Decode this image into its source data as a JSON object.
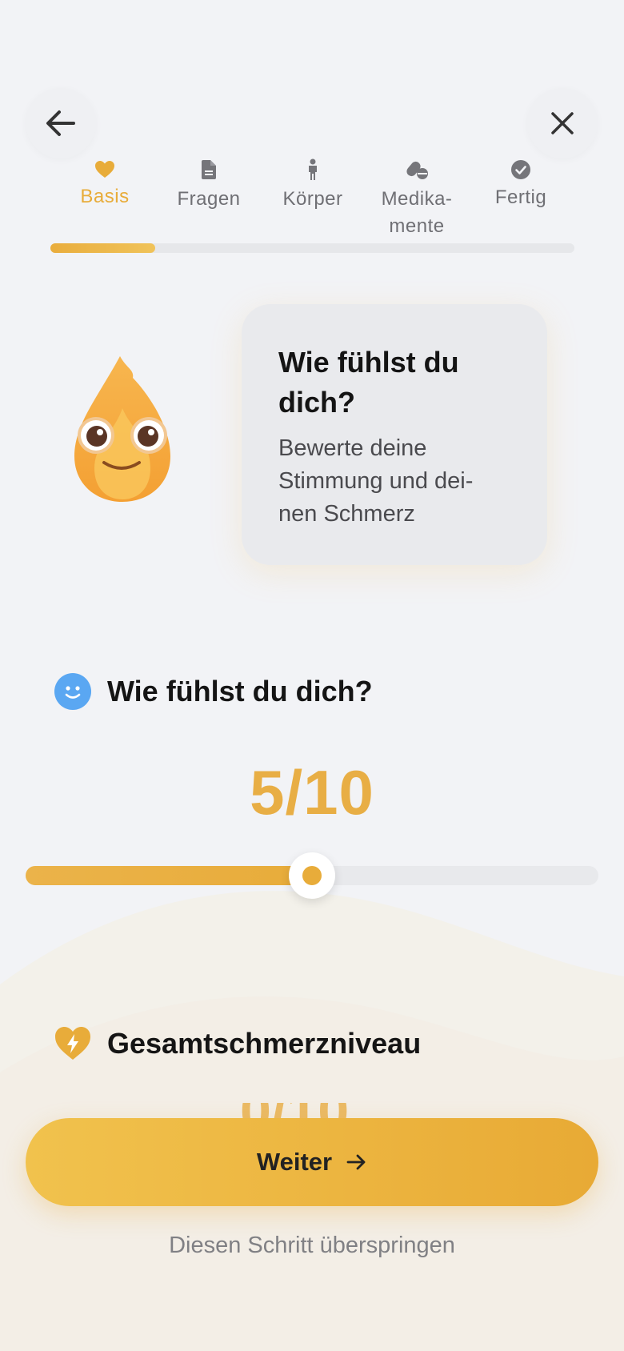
{
  "steps": [
    {
      "label": "Basis",
      "icon": "heart-icon",
      "active": true
    },
    {
      "label": "Fragen",
      "icon": "document-icon",
      "active": false
    },
    {
      "label": "Körper",
      "icon": "person-icon",
      "active": false
    },
    {
      "label": "Medika-",
      "label2": "mente",
      "icon": "pills-icon",
      "active": false
    },
    {
      "label": "Fertig",
      "icon": "check-circle-icon",
      "active": false
    }
  ],
  "step_progress": 0.2,
  "hero": {
    "title_line1": "Wie fühlst du",
    "title_line2": "dich?",
    "subtitle_line1": "Bewerte deine",
    "subtitle_line2": "Stimmung und dei-",
    "subtitle_line3": "nen Schmerz"
  },
  "mood": {
    "title": "Wie fühlst du dich?",
    "value_label": "5/10",
    "value": 5,
    "max": 10
  },
  "pain": {
    "title": "Gesamtschmerzniveau",
    "peek_value": "0/10"
  },
  "actions": {
    "next_label": "Weiter",
    "skip_label": "Diesen Schritt überspringen"
  },
  "colors": {
    "accent": "#e8ac3a",
    "inactive": "#6f6f74",
    "mood_icon": "#5aa7f2"
  }
}
